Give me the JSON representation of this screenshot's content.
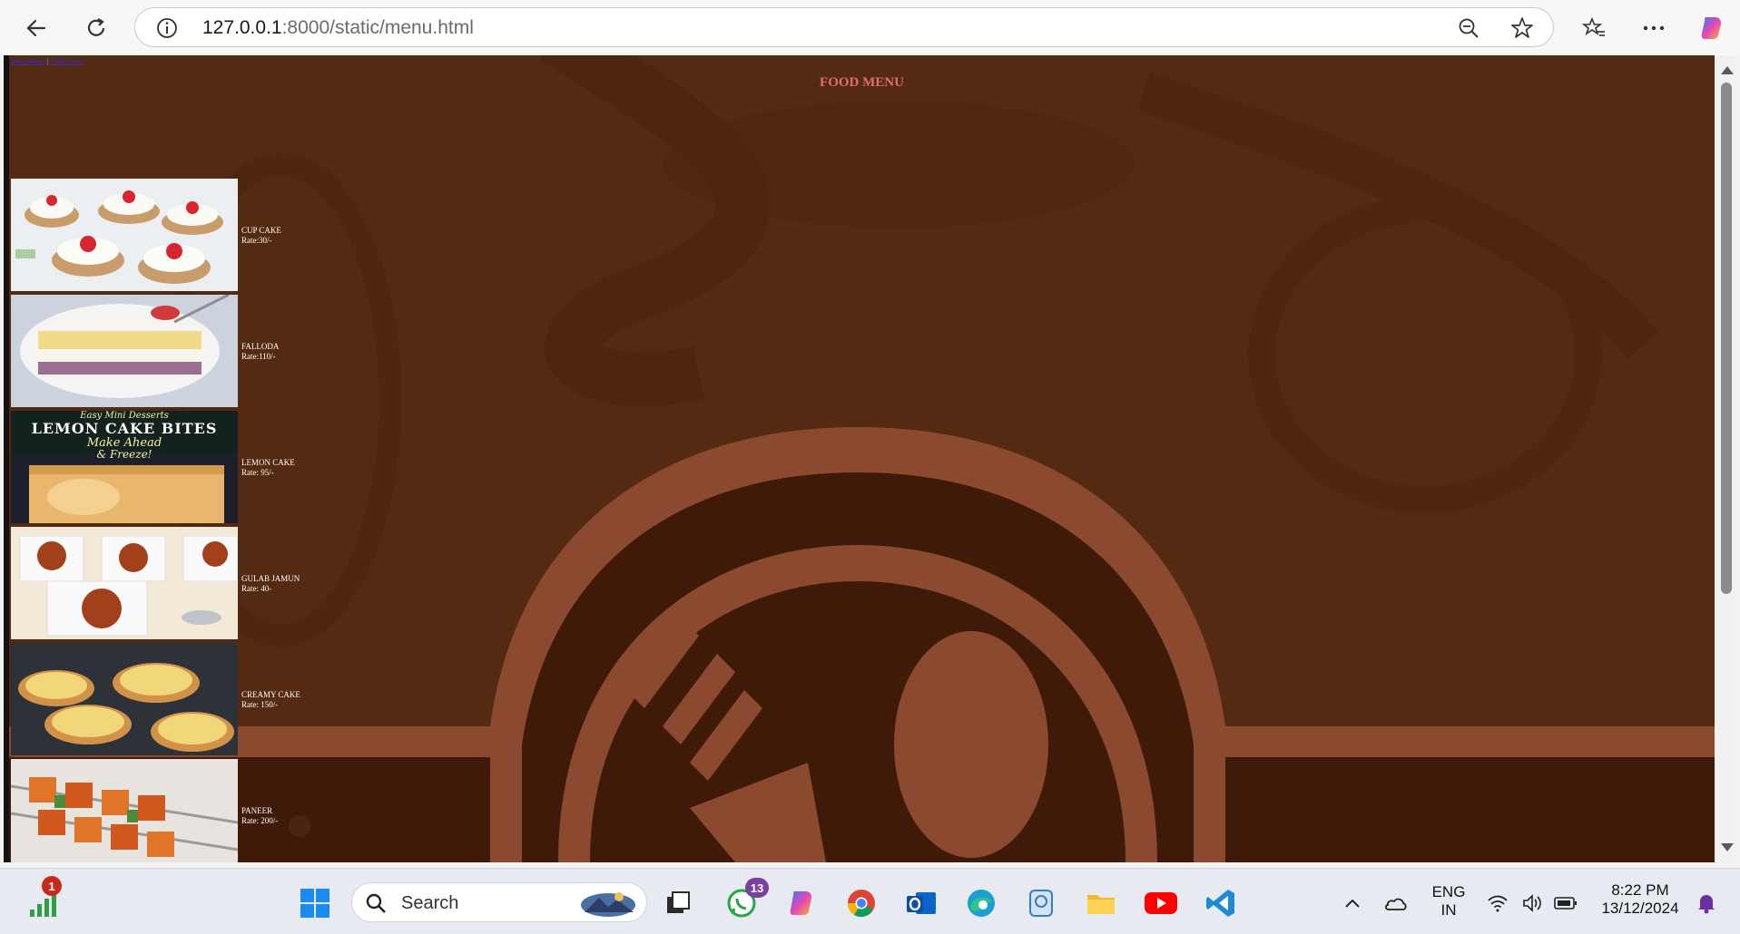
{
  "browser": {
    "url_host": "127.0.0.1",
    "url_path": ":8000/static/menu.html"
  },
  "page": {
    "top_links": [
      "Main Menu",
      "|",
      "Order Now"
    ],
    "title": "FOOD MENU",
    "items": [
      {
        "name": "CUP CAKE",
        "rate": "Rate:30/-"
      },
      {
        "name": "FALLODA",
        "rate": "Rate:110/-"
      },
      {
        "name": "LEMON CAKE",
        "rate": "Rate: 95/-"
      },
      {
        "name": "GULAB JAMUN",
        "rate": "Rate: 40-"
      },
      {
        "name": "CREAMY CAKE",
        "rate": "Rate: 150/-"
      },
      {
        "name": "PANEER",
        "rate": "Rate: 200/-"
      }
    ],
    "lemon_banner": {
      "line1": "Easy Mini Desserts",
      "line2": "LEMON CAKE BITES",
      "line3": "Make Ahead",
      "line4": "& Freeze!"
    },
    "colors": {
      "background": "#552a12",
      "title": "#e06a7c",
      "plate": "#8b4a30"
    }
  },
  "taskbar": {
    "search_label": "Search",
    "lang_line1": "ENG",
    "lang_line2": "IN",
    "time": "8:22 PM",
    "date": "13/12/2024",
    "whatsapp_badge": "13",
    "network_badge": "1"
  }
}
